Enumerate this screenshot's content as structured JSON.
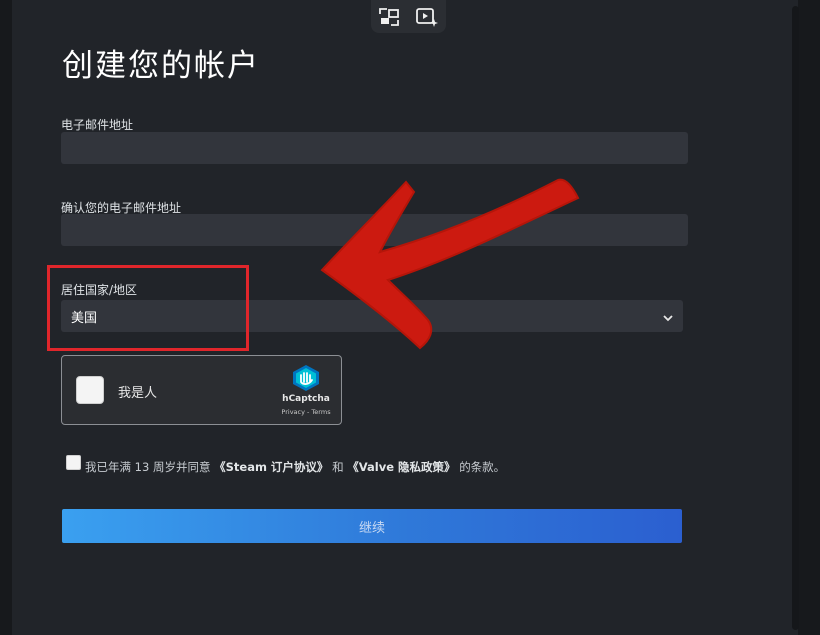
{
  "page": {
    "title": "创建您的帐户"
  },
  "form": {
    "email_label": "电子邮件地址",
    "email_value": "",
    "confirm_email_label": "确认您的电子邮件地址",
    "confirm_email_value": "",
    "country_label": "居住国家/地区",
    "country_selected": "美国"
  },
  "captcha": {
    "prompt": "我是人",
    "brand": "hCaptcha",
    "links": "Privacy - Terms"
  },
  "agreement": {
    "checked": false,
    "text_prefix": "我已年满 13 周岁并同意",
    "steam_link": "《Steam 订户协议》",
    "text_middle": "和",
    "valve_link": "《Valve 隐私政策》",
    "text_suffix": "的条款。"
  },
  "buttons": {
    "continue_label": "继续"
  },
  "overlay": {
    "pip_icons": [
      "picture-in-picture-icon",
      "video-sparkle-icon"
    ],
    "annotation_color": "#e0262b",
    "arrow_color": "#cc1a10"
  },
  "colors": {
    "background": "#212429",
    "field": "#32353c",
    "button_start": "#3aa0f0",
    "button_end": "#2b5fd0"
  }
}
